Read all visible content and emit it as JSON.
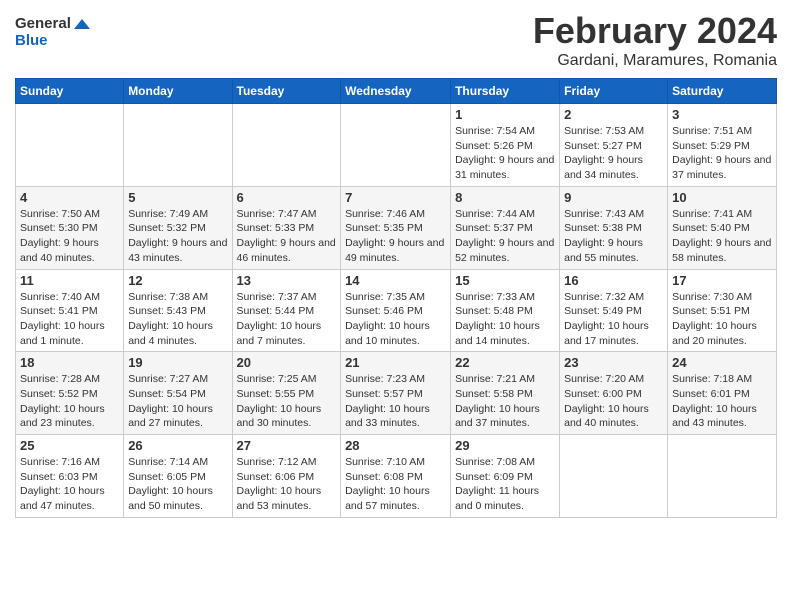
{
  "header": {
    "logo_line1": "General",
    "logo_line2": "Blue",
    "month": "February 2024",
    "location": "Gardani, Maramures, Romania"
  },
  "weekdays": [
    "Sunday",
    "Monday",
    "Tuesday",
    "Wednesday",
    "Thursday",
    "Friday",
    "Saturday"
  ],
  "weeks": [
    [
      {
        "day": "",
        "sunrise": "",
        "sunset": "",
        "daylight": ""
      },
      {
        "day": "",
        "sunrise": "",
        "sunset": "",
        "daylight": ""
      },
      {
        "day": "",
        "sunrise": "",
        "sunset": "",
        "daylight": ""
      },
      {
        "day": "",
        "sunrise": "",
        "sunset": "",
        "daylight": ""
      },
      {
        "day": "1",
        "sunrise": "Sunrise: 7:54 AM",
        "sunset": "Sunset: 5:26 PM",
        "daylight": "Daylight: 9 hours and 31 minutes."
      },
      {
        "day": "2",
        "sunrise": "Sunrise: 7:53 AM",
        "sunset": "Sunset: 5:27 PM",
        "daylight": "Daylight: 9 hours and 34 minutes."
      },
      {
        "day": "3",
        "sunrise": "Sunrise: 7:51 AM",
        "sunset": "Sunset: 5:29 PM",
        "daylight": "Daylight: 9 hours and 37 minutes."
      }
    ],
    [
      {
        "day": "4",
        "sunrise": "Sunrise: 7:50 AM",
        "sunset": "Sunset: 5:30 PM",
        "daylight": "Daylight: 9 hours and 40 minutes."
      },
      {
        "day": "5",
        "sunrise": "Sunrise: 7:49 AM",
        "sunset": "Sunset: 5:32 PM",
        "daylight": "Daylight: 9 hours and 43 minutes."
      },
      {
        "day": "6",
        "sunrise": "Sunrise: 7:47 AM",
        "sunset": "Sunset: 5:33 PM",
        "daylight": "Daylight: 9 hours and 46 minutes."
      },
      {
        "day": "7",
        "sunrise": "Sunrise: 7:46 AM",
        "sunset": "Sunset: 5:35 PM",
        "daylight": "Daylight: 9 hours and 49 minutes."
      },
      {
        "day": "8",
        "sunrise": "Sunrise: 7:44 AM",
        "sunset": "Sunset: 5:37 PM",
        "daylight": "Daylight: 9 hours and 52 minutes."
      },
      {
        "day": "9",
        "sunrise": "Sunrise: 7:43 AM",
        "sunset": "Sunset: 5:38 PM",
        "daylight": "Daylight: 9 hours and 55 minutes."
      },
      {
        "day": "10",
        "sunrise": "Sunrise: 7:41 AM",
        "sunset": "Sunset: 5:40 PM",
        "daylight": "Daylight: 9 hours and 58 minutes."
      }
    ],
    [
      {
        "day": "11",
        "sunrise": "Sunrise: 7:40 AM",
        "sunset": "Sunset: 5:41 PM",
        "daylight": "Daylight: 10 hours and 1 minute."
      },
      {
        "day": "12",
        "sunrise": "Sunrise: 7:38 AM",
        "sunset": "Sunset: 5:43 PM",
        "daylight": "Daylight: 10 hours and 4 minutes."
      },
      {
        "day": "13",
        "sunrise": "Sunrise: 7:37 AM",
        "sunset": "Sunset: 5:44 PM",
        "daylight": "Daylight: 10 hours and 7 minutes."
      },
      {
        "day": "14",
        "sunrise": "Sunrise: 7:35 AM",
        "sunset": "Sunset: 5:46 PM",
        "daylight": "Daylight: 10 hours and 10 minutes."
      },
      {
        "day": "15",
        "sunrise": "Sunrise: 7:33 AM",
        "sunset": "Sunset: 5:48 PM",
        "daylight": "Daylight: 10 hours and 14 minutes."
      },
      {
        "day": "16",
        "sunrise": "Sunrise: 7:32 AM",
        "sunset": "Sunset: 5:49 PM",
        "daylight": "Daylight: 10 hours and 17 minutes."
      },
      {
        "day": "17",
        "sunrise": "Sunrise: 7:30 AM",
        "sunset": "Sunset: 5:51 PM",
        "daylight": "Daylight: 10 hours and 20 minutes."
      }
    ],
    [
      {
        "day": "18",
        "sunrise": "Sunrise: 7:28 AM",
        "sunset": "Sunset: 5:52 PM",
        "daylight": "Daylight: 10 hours and 23 minutes."
      },
      {
        "day": "19",
        "sunrise": "Sunrise: 7:27 AM",
        "sunset": "Sunset: 5:54 PM",
        "daylight": "Daylight: 10 hours and 27 minutes."
      },
      {
        "day": "20",
        "sunrise": "Sunrise: 7:25 AM",
        "sunset": "Sunset: 5:55 PM",
        "daylight": "Daylight: 10 hours and 30 minutes."
      },
      {
        "day": "21",
        "sunrise": "Sunrise: 7:23 AM",
        "sunset": "Sunset: 5:57 PM",
        "daylight": "Daylight: 10 hours and 33 minutes."
      },
      {
        "day": "22",
        "sunrise": "Sunrise: 7:21 AM",
        "sunset": "Sunset: 5:58 PM",
        "daylight": "Daylight: 10 hours and 37 minutes."
      },
      {
        "day": "23",
        "sunrise": "Sunrise: 7:20 AM",
        "sunset": "Sunset: 6:00 PM",
        "daylight": "Daylight: 10 hours and 40 minutes."
      },
      {
        "day": "24",
        "sunrise": "Sunrise: 7:18 AM",
        "sunset": "Sunset: 6:01 PM",
        "daylight": "Daylight: 10 hours and 43 minutes."
      }
    ],
    [
      {
        "day": "25",
        "sunrise": "Sunrise: 7:16 AM",
        "sunset": "Sunset: 6:03 PM",
        "daylight": "Daylight: 10 hours and 47 minutes."
      },
      {
        "day": "26",
        "sunrise": "Sunrise: 7:14 AM",
        "sunset": "Sunset: 6:05 PM",
        "daylight": "Daylight: 10 hours and 50 minutes."
      },
      {
        "day": "27",
        "sunrise": "Sunrise: 7:12 AM",
        "sunset": "Sunset: 6:06 PM",
        "daylight": "Daylight: 10 hours and 53 minutes."
      },
      {
        "day": "28",
        "sunrise": "Sunrise: 7:10 AM",
        "sunset": "Sunset: 6:08 PM",
        "daylight": "Daylight: 10 hours and 57 minutes."
      },
      {
        "day": "29",
        "sunrise": "Sunrise: 7:08 AM",
        "sunset": "Sunset: 6:09 PM",
        "daylight": "Daylight: 11 hours and 0 minutes."
      },
      {
        "day": "",
        "sunrise": "",
        "sunset": "",
        "daylight": ""
      },
      {
        "day": "",
        "sunrise": "",
        "sunset": "",
        "daylight": ""
      }
    ]
  ]
}
